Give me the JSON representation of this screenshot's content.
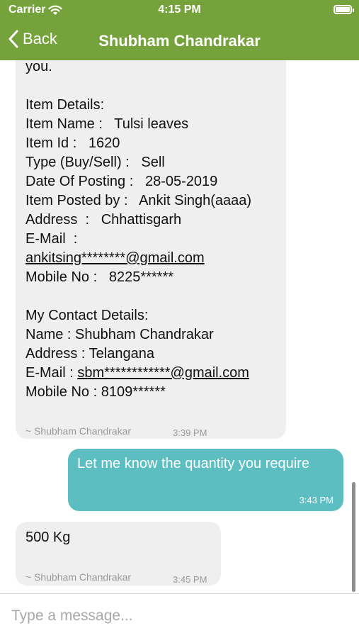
{
  "status_bar": {
    "carrier": "Carrier",
    "time": "4:15 PM"
  },
  "nav": {
    "back_label": "Back",
    "title": "Shubham Chandrakar"
  },
  "messages": [
    {
      "direction": "incoming",
      "lines": [
        "you.",
        "",
        "Item Details:",
        "Item Name :   Tulsi leaves",
        "Item Id :   1620",
        "Type (Buy/Sell) :   Sell",
        "Date Of Posting :   28-05-2019",
        "Item Posted by :   Ankit Singh(aaaa)",
        "Address  :   Chhattisgarh",
        "E-Mail  :",
        "ankitsing********@gmail.com",
        "Mobile No :   8225******",
        "",
        "My Contact Details:",
        "Name : Shubham Chandrakar",
        "Address : Telangana",
        "E-Mail : sbm************@gmail.com",
        "Mobile No : 8109******"
      ],
      "sender": "~ Shubham Chandrakar",
      "time": "3:39 PM"
    },
    {
      "direction": "outgoing",
      "text": "Let me know the quantity you require",
      "time": "3:43 PM"
    },
    {
      "direction": "incoming",
      "text": "500 Kg",
      "sender": "~ Shubham Chandrakar",
      "time": "3:45 PM"
    }
  ],
  "composer": {
    "placeholder": "Type a message..."
  },
  "colors": {
    "header": "#76a23c",
    "outgoing_bubble": "#5cbec1",
    "incoming_bubble": "#efefef"
  }
}
